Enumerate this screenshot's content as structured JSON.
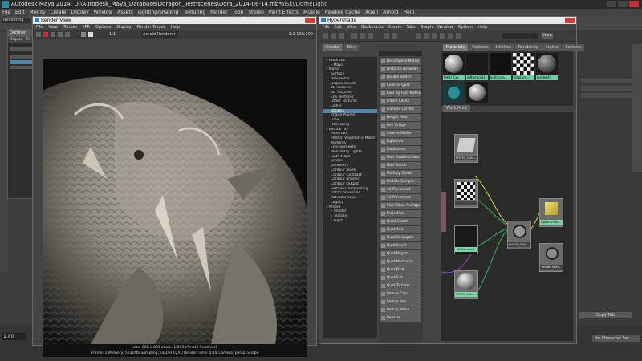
{
  "app": {
    "title": "Autodesk Maya 2014: D:\\Autodesk_Maya_Database\\Doragon_Test\\scenes\\Dora_2014-06-14.mb*",
    "selection": "aiSkyDomeLight",
    "menu": [
      "File",
      "Edit",
      "Modify",
      "Create",
      "Display",
      "Window",
      "Assets",
      "Lighting/Shading",
      "Texturing",
      "Render",
      "Toon",
      "Stereo",
      "Paint Effects",
      "Muscle",
      "Pipeline Cache",
      "XGen",
      "Arnold",
      "Help"
    ],
    "mode": "Rendering",
    "outliner_title": "Outliner",
    "outliner_menu": [
      "Display",
      "Sh"
    ],
    "time_field": "1.00",
    "no_character_set": "No Character Set",
    "copy_tab": "Copy Tab"
  },
  "render_view": {
    "title": "Render View",
    "menu": [
      "File",
      "View",
      "Render",
      "IPR",
      "Options",
      "Display",
      "Render Target",
      "Help"
    ],
    "zoom": "1:1",
    "renderer": "Arnold Renderer",
    "resolution": "1:1 100:100",
    "status_line1": "size: 800 x 800  zoom: 1.000    (Arnold Renderer)",
    "status_line2": "Frame: 1    Memory: 5031Mb    Sampling: [4/3/2/2/2/0]    Render Time: 0:19    Camera: persp1Shape"
  },
  "hypershade": {
    "title": "Hypershade",
    "menu": [
      "File",
      "Edit",
      "View",
      "Bookmarks",
      "Create",
      "Tabs",
      "Graph",
      "Window",
      "Options",
      "Help"
    ],
    "show_button": "Show",
    "create_tabs": [
      "Create",
      "Bins"
    ],
    "categories": [
      {
        "label": "▿ Favorites",
        "level": 0
      },
      {
        "label": "▹ Maya",
        "level": 1
      },
      {
        "label": "▿ Maya",
        "level": 0
      },
      {
        "label": "Surface",
        "level": 1
      },
      {
        "label": "Volumetric",
        "level": 1
      },
      {
        "label": "Displacement",
        "level": 1
      },
      {
        "label": "2D Textures",
        "level": 1
      },
      {
        "label": "3D Textures",
        "level": 1
      },
      {
        "label": "Env Textures",
        "level": 1
      },
      {
        "label": "Other Textures",
        "level": 1
      },
      {
        "label": "Lights",
        "level": 1
      },
      {
        "label": "Utilities",
        "level": 1,
        "selected": true
      },
      {
        "label": "Image Planes",
        "level": 1
      },
      {
        "label": "Glow",
        "level": 1
      },
      {
        "label": "Rendering",
        "level": 1
      },
      {
        "label": "▿ mental ray",
        "level": 0
      },
      {
        "label": "Materials",
        "level": 1
      },
      {
        "label": "Photon Volumetric Materi",
        "level": 1
      },
      {
        "label": "Textures",
        "level": 1
      },
      {
        "label": "Environments",
        "level": 1
      },
      {
        "label": "MentalRay Lights",
        "level": 1
      },
      {
        "label": "Light Maps",
        "level": 1
      },
      {
        "label": "Lenses",
        "level": 1
      },
      {
        "label": "Geometry",
        "level": 1
      },
      {
        "label": "Contour Store",
        "level": 1
      },
      {
        "label": "Contour Contrast",
        "level": 1
      },
      {
        "label": "Contour Shader",
        "level": 1
      },
      {
        "label": "Contour Output",
        "level": 1
      },
      {
        "label": "Sample Compositing",
        "level": 1
      },
      {
        "label": "Data Conversion",
        "level": 1
      },
      {
        "label": "Miscellaneous",
        "level": 1
      },
      {
        "label": "Legacy",
        "level": 1
      },
      {
        "label": "▿ Arnold",
        "level": 0
      },
      {
        "label": "▹ Shader",
        "level": 1
      },
      {
        "label": "▹ Texture",
        "level": 1
      },
      {
        "label": "▹ Light",
        "level": 1
      }
    ],
    "nodes": [
      "Decompose Matrix",
      "Distance Between",
      "Double Switch",
      "Euler To Quat",
      "Four By Four Matrix",
      "Frame Cache",
      "Gamma Correct",
      "Height Field",
      "Hsv To Rgb",
      "Inverse Matrix",
      "Light Info",
      "Luminance",
      "Mult Double Linear",
      "Mult Matrix",
      "Multiply Divide",
      "Particle Sampler",
      "2d Placement",
      "3d Placement",
      "Plus Minus Average",
      "Projection",
      "Quad Switch",
      "Quat Add",
      "Quat Conjugate",
      "Quat Invert",
      "Quat Negate",
      "Quat Normalize",
      "Quat Prod",
      "Quat Sub",
      "Quat To Euler",
      "Remap Color",
      "Remap Hsv",
      "Remap Value",
      "Reverse"
    ],
    "material_tabs": [
      "Materials",
      "Textures",
      "Utilities",
      "Rendering",
      "Lights",
      "Camera"
    ],
    "swatches": [
      "PHIO_Cyl...",
      "aiBump2d1",
      "aiStanda...",
      "displace...",
      "lambert1"
    ],
    "work_area_tab": "Work Area",
    "graph_nodes": [
      "PH130_Cylin...",
      "",
      "aiStandard1",
      "PH130_Cylin...",
      "PH130_Cylin...",
      "BgAsLumanl...",
      "render Parti..."
    ]
  }
}
